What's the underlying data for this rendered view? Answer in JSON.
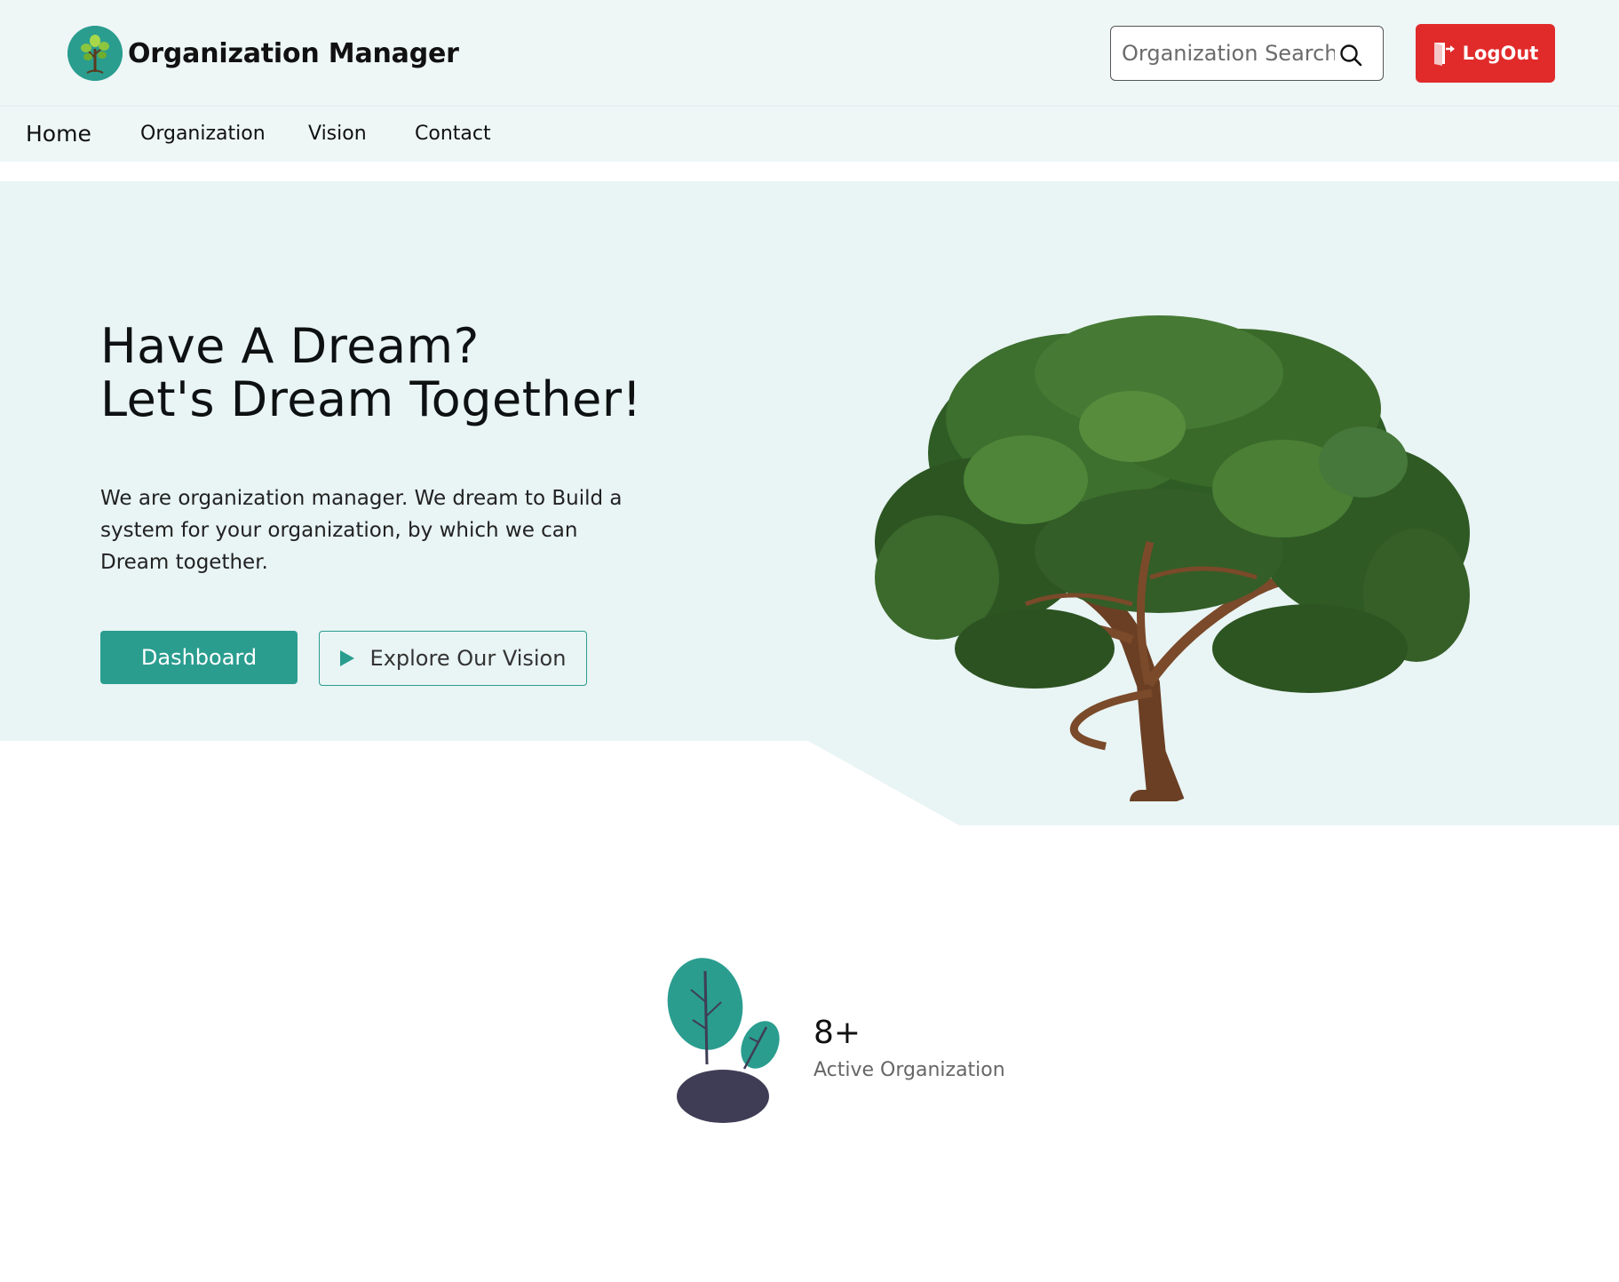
{
  "header": {
    "brand_name": "Organization Manager",
    "search_placeholder": "Organization Search",
    "logout_label": "LogOut"
  },
  "nav": {
    "items": [
      {
        "label": "Home",
        "active": true
      },
      {
        "label": "Organization",
        "active": false
      },
      {
        "label": "Vision",
        "active": false
      },
      {
        "label": "Contact",
        "active": false
      }
    ]
  },
  "hero": {
    "headline_line1": "Have A Dream?",
    "headline_line2": "Let's Dream Together!",
    "description": "We are organization manager. We dream to Build a system for your organization, by which we can Dream together.",
    "dashboard_label": "Dashboard",
    "explore_label": "Explore Our Vision"
  },
  "stats": {
    "value": "8+",
    "label": "Active Organization"
  },
  "colors": {
    "accent": "#2a9d8f",
    "logout": "#e12a2a",
    "hero_bg": "#e9f4f4",
    "header_bg": "#eef6f6"
  },
  "icons": [
    "tree-logo-icon",
    "search-icon",
    "logout-icon",
    "play-icon",
    "tree-image",
    "plant-illustration"
  ]
}
